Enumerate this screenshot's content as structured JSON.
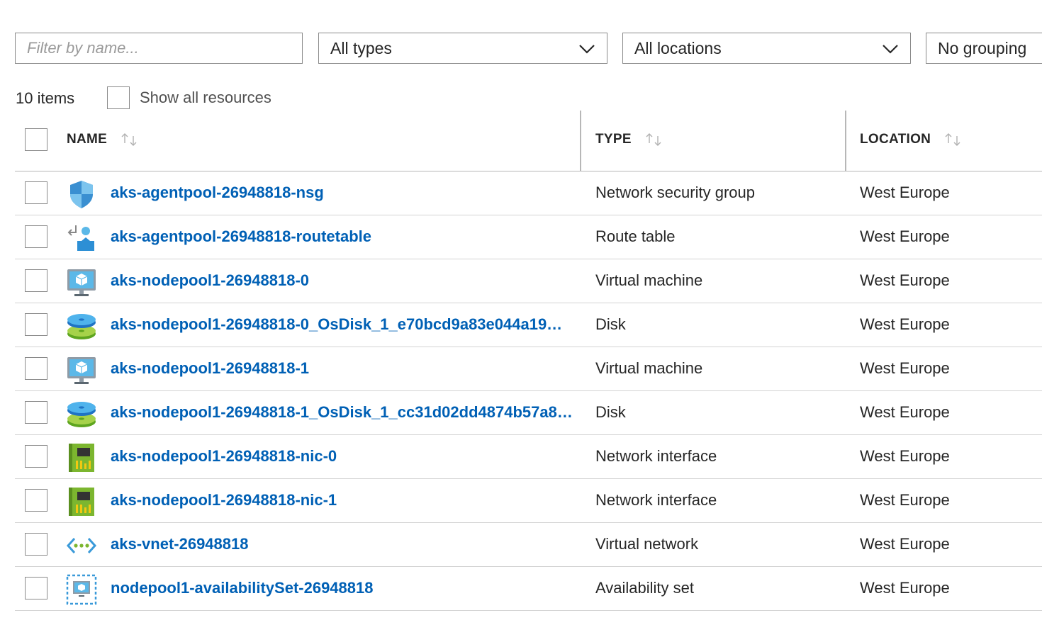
{
  "filters": {
    "name_placeholder": "Filter by name...",
    "types_value": "All types",
    "locations_value": "All locations",
    "grouping_value": "No grouping"
  },
  "summary": {
    "count_label": "10 items",
    "show_all_label": "Show all resources"
  },
  "columns": {
    "name": "NAME",
    "type": "TYPE",
    "location": "LOCATION"
  },
  "rows": [
    {
      "name": "aks-agentpool-26948818-nsg",
      "type": "Network security group",
      "location": "West Europe",
      "icon": "network-security-group-icon"
    },
    {
      "name": "aks-agentpool-26948818-routetable",
      "type": "Route table",
      "location": "West Europe",
      "icon": "route-table-icon"
    },
    {
      "name": "aks-nodepool1-26948818-0",
      "type": "Virtual machine",
      "location": "West Europe",
      "icon": "virtual-machine-icon"
    },
    {
      "name": "aks-nodepool1-26948818-0_OsDisk_1_e70bcd9a83e044a19…",
      "type": "Disk",
      "location": "West Europe",
      "icon": "disk-icon"
    },
    {
      "name": "aks-nodepool1-26948818-1",
      "type": "Virtual machine",
      "location": "West Europe",
      "icon": "virtual-machine-icon"
    },
    {
      "name": "aks-nodepool1-26948818-1_OsDisk_1_cc31d02dd4874b57a8…",
      "type": "Disk",
      "location": "West Europe",
      "icon": "disk-icon"
    },
    {
      "name": "aks-nodepool1-26948818-nic-0",
      "type": "Network interface",
      "location": "West Europe",
      "icon": "network-interface-icon"
    },
    {
      "name": "aks-nodepool1-26948818-nic-1",
      "type": "Network interface",
      "location": "West Europe",
      "icon": "network-interface-icon"
    },
    {
      "name": "aks-vnet-26948818",
      "type": "Virtual network",
      "location": "West Europe",
      "icon": "virtual-network-icon"
    },
    {
      "name": "nodepool1-availabilitySet-26948818",
      "type": "Availability set",
      "location": "West Europe",
      "icon": "availability-set-icon"
    }
  ]
}
